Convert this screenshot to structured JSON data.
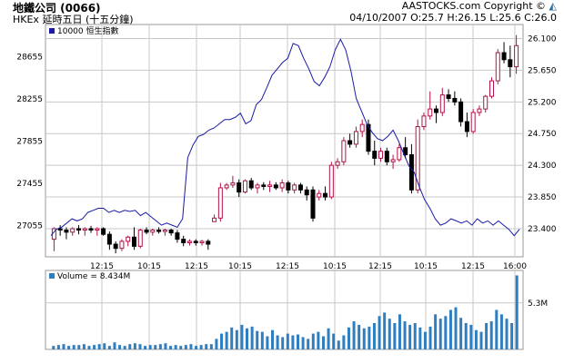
{
  "header": {
    "title": "地鐵公司 (0066)",
    "subtitle": "HKEx 延時五日 (十五分鐘)",
    "copyright": "AASTOCKS.com Copyright ©",
    "quote_line": "04/10/2007  O:25.7  H:26.15  L:25.6  C:26.0"
  },
  "colors": {
    "up": "#b0124a",
    "down": "#000000",
    "index_line": "#1a1aa6",
    "volume": "#2f7fc0",
    "grid": "#c8c8c8",
    "frame": "#999999"
  },
  "chart_data": [
    {
      "type": "candlestick",
      "title": "",
      "x_tick_labels": [
        "12:15",
        "10:15",
        "12:15",
        "10:15",
        "12:15",
        "10:15",
        "12:15",
        "10:15",
        "12:15",
        "16:00"
      ],
      "y_right_ticks": [
        23.4,
        23.85,
        24.3,
        24.75,
        25.2,
        25.65,
        26.1
      ],
      "y_left_ticks": [
        27055,
        27455,
        27855,
        28255,
        28655
      ],
      "ylim_price": [
        23.0,
        26.3
      ],
      "ylim_index": [
        26760,
        28960
      ],
      "legend": "10000 恒生指數",
      "candles": [
        {
          "o": 23.25,
          "h": 23.42,
          "l": 23.08,
          "c": 23.4
        },
        {
          "o": 23.4,
          "h": 23.45,
          "l": 23.3,
          "c": 23.38
        },
        {
          "o": 23.38,
          "h": 23.42,
          "l": 23.25,
          "c": 23.35
        },
        {
          "o": 23.35,
          "h": 23.42,
          "l": 23.3,
          "c": 23.4
        },
        {
          "o": 23.4,
          "h": 23.45,
          "l": 23.32,
          "c": 23.38
        },
        {
          "o": 23.38,
          "h": 23.42,
          "l": 23.3,
          "c": 23.4
        },
        {
          "o": 23.4,
          "h": 23.44,
          "l": 23.34,
          "c": 23.38
        },
        {
          "o": 23.38,
          "h": 23.42,
          "l": 23.3,
          "c": 23.4
        },
        {
          "o": 23.4,
          "h": 23.42,
          "l": 23.3,
          "c": 23.32
        },
        {
          "o": 23.32,
          "h": 23.36,
          "l": 23.1,
          "c": 23.18
        },
        {
          "o": 23.18,
          "h": 23.22,
          "l": 23.05,
          "c": 23.12
        },
        {
          "o": 23.12,
          "h": 23.25,
          "l": 23.08,
          "c": 23.22
        },
        {
          "o": 23.22,
          "h": 23.3,
          "l": 23.15,
          "c": 23.28
        },
        {
          "o": 23.28,
          "h": 23.42,
          "l": 23.1,
          "c": 23.15
        },
        {
          "o": 23.15,
          "h": 23.4,
          "l": 23.12,
          "c": 23.38
        },
        {
          "o": 23.38,
          "h": 23.42,
          "l": 23.32,
          "c": 23.35
        },
        {
          "o": 23.35,
          "h": 23.4,
          "l": 23.3,
          "c": 23.38
        },
        {
          "o": 23.38,
          "h": 23.42,
          "l": 23.33,
          "c": 23.36
        },
        {
          "o": 23.36,
          "h": 23.4,
          "l": 23.3,
          "c": 23.38
        },
        {
          "o": 23.38,
          "h": 23.4,
          "l": 23.3,
          "c": 23.34
        },
        {
          "o": 23.34,
          "h": 23.38,
          "l": 23.2,
          "c": 23.25
        },
        {
          "o": 23.25,
          "h": 23.3,
          "l": 23.15,
          "c": 23.2
        },
        {
          "o": 23.2,
          "h": 23.25,
          "l": 23.16,
          "c": 23.22
        },
        {
          "o": 23.22,
          "h": 23.25,
          "l": 23.16,
          "c": 23.2
        },
        {
          "o": 23.2,
          "h": 23.24,
          "l": 23.16,
          "c": 23.22
        },
        {
          "o": 23.22,
          "h": 23.25,
          "l": 23.1,
          "c": 23.18
        },
        {
          "o": 23.5,
          "h": 23.6,
          "l": 23.5,
          "c": 23.55
        },
        {
          "o": 23.55,
          "h": 24.05,
          "l": 23.5,
          "c": 23.98
        },
        {
          "o": 23.98,
          "h": 24.05,
          "l": 23.95,
          "c": 24.02
        },
        {
          "o": 24.02,
          "h": 24.15,
          "l": 23.98,
          "c": 24.05
        },
        {
          "o": 24.05,
          "h": 24.1,
          "l": 23.85,
          "c": 23.92
        },
        {
          "o": 23.92,
          "h": 24.1,
          "l": 23.9,
          "c": 24.08
        },
        {
          "o": 24.08,
          "h": 24.12,
          "l": 23.95,
          "c": 23.98
        },
        {
          "o": 23.98,
          "h": 24.05,
          "l": 23.9,
          "c": 24.02
        },
        {
          "o": 24.02,
          "h": 24.06,
          "l": 23.95,
          "c": 24.0
        },
        {
          "o": 24.0,
          "h": 24.08,
          "l": 23.92,
          "c": 24.02
        },
        {
          "o": 24.02,
          "h": 24.06,
          "l": 23.95,
          "c": 23.98
        },
        {
          "o": 23.98,
          "h": 24.1,
          "l": 23.92,
          "c": 24.05
        },
        {
          "o": 24.05,
          "h": 24.08,
          "l": 23.9,
          "c": 23.95
        },
        {
          "o": 23.95,
          "h": 24.05,
          "l": 23.9,
          "c": 24.02
        },
        {
          "o": 24.02,
          "h": 24.05,
          "l": 23.9,
          "c": 23.95
        },
        {
          "o": 23.95,
          "h": 24.0,
          "l": 23.8,
          "c": 23.88
        },
        {
          "o": 23.95,
          "h": 24.0,
          "l": 23.5,
          "c": 23.55
        },
        {
          "o": 23.85,
          "h": 23.95,
          "l": 23.8,
          "c": 23.9
        },
        {
          "o": 23.9,
          "h": 24.0,
          "l": 23.8,
          "c": 23.85
        },
        {
          "o": 23.85,
          "h": 24.35,
          "l": 23.82,
          "c": 24.3
        },
        {
          "o": 24.3,
          "h": 24.4,
          "l": 24.25,
          "c": 24.35
        },
        {
          "o": 24.35,
          "h": 24.7,
          "l": 24.3,
          "c": 24.65
        },
        {
          "o": 24.65,
          "h": 24.75,
          "l": 24.55,
          "c": 24.6
        },
        {
          "o": 24.6,
          "h": 24.85,
          "l": 24.55,
          "c": 24.78
        },
        {
          "o": 24.78,
          "h": 24.95,
          "l": 24.7,
          "c": 24.88
        },
        {
          "o": 24.88,
          "h": 24.95,
          "l": 24.45,
          "c": 24.5
        },
        {
          "o": 24.5,
          "h": 24.65,
          "l": 24.3,
          "c": 24.4
        },
        {
          "o": 24.4,
          "h": 24.55,
          "l": 24.35,
          "c": 24.5
        },
        {
          "o": 24.5,
          "h": 24.55,
          "l": 24.3,
          "c": 24.35
        },
        {
          "o": 24.35,
          "h": 24.45,
          "l": 24.25,
          "c": 24.38
        },
        {
          "o": 24.38,
          "h": 24.6,
          "l": 24.35,
          "c": 24.55
        },
        {
          "o": 24.55,
          "h": 24.7,
          "l": 24.4,
          "c": 24.45
        },
        {
          "o": 24.45,
          "h": 24.6,
          "l": 23.9,
          "c": 23.95
        },
        {
          "o": 23.95,
          "h": 24.95,
          "l": 23.9,
          "c": 24.85
        },
        {
          "o": 24.85,
          "h": 25.05,
          "l": 24.8,
          "c": 25.0
        },
        {
          "o": 25.0,
          "h": 25.35,
          "l": 24.95,
          "c": 25.1
        },
        {
          "o": 25.1,
          "h": 25.15,
          "l": 24.9,
          "c": 25.05
        },
        {
          "o": 25.05,
          "h": 25.4,
          "l": 25.0,
          "c": 25.3
        },
        {
          "o": 25.3,
          "h": 25.38,
          "l": 25.2,
          "c": 25.25
        },
        {
          "o": 25.25,
          "h": 25.35,
          "l": 25.15,
          "c": 25.2
        },
        {
          "o": 25.2,
          "h": 25.25,
          "l": 24.85,
          "c": 24.92
        },
        {
          "o": 24.92,
          "h": 25.05,
          "l": 24.7,
          "c": 24.78
        },
        {
          "o": 24.78,
          "h": 25.1,
          "l": 24.75,
          "c": 25.05
        },
        {
          "o": 25.05,
          "h": 25.15,
          "l": 25.0,
          "c": 25.1
        },
        {
          "o": 25.1,
          "h": 25.3,
          "l": 25.05,
          "c": 25.28
        },
        {
          "o": 25.28,
          "h": 25.55,
          "l": 25.25,
          "c": 25.5
        },
        {
          "o": 25.5,
          "h": 25.95,
          "l": 25.45,
          "c": 25.9
        },
        {
          "o": 25.9,
          "h": 26.05,
          "l": 25.75,
          "c": 25.8
        },
        {
          "o": 25.8,
          "h": 26.0,
          "l": 25.55,
          "c": 25.7
        },
        {
          "o": 25.7,
          "h": 26.15,
          "l": 25.6,
          "c": 26.0
        }
      ],
      "index_series": [
        26960,
        27020,
        27040,
        27080,
        27120,
        27100,
        27120,
        27180,
        27200,
        27220,
        27220,
        27180,
        27200,
        27180,
        27200,
        27190,
        27200,
        27150,
        27180,
        27140,
        27100,
        27060,
        27080,
        27060,
        27040,
        27120,
        27700,
        27820,
        27900,
        27920,
        27960,
        27980,
        28020,
        28060,
        28060,
        28080,
        28120,
        28020,
        28050,
        28200,
        28250,
        28360,
        28480,
        28540,
        28600,
        28640,
        28780,
        28760,
        28640,
        28540,
        28420,
        28380,
        28460,
        28560,
        28720,
        28820,
        28720,
        28520,
        28260,
        28140,
        28020,
        27940,
        27880,
        27860,
        27900,
        27960,
        27860,
        27740,
        27620,
        27560,
        27420,
        27300,
        27220,
        27120,
        27060,
        27080,
        27120,
        27100,
        27080,
        27100,
        27060,
        27120,
        27080,
        27100,
        27060,
        27100,
        27060,
        27020,
        26960,
        27020
      ]
    },
    {
      "type": "bar",
      "title": "",
      "legend_label": "Volume = 8.434M",
      "y_tick_label": "5.3M",
      "y_tick_value": 5.3,
      "ylim": [
        0,
        9.0
      ],
      "unit": "M",
      "values": [
        0.4,
        0.5,
        0.6,
        0.4,
        0.5,
        0.5,
        0.6,
        0.4,
        0.5,
        0.6,
        0.7,
        0.4,
        0.8,
        0.5,
        0.4,
        0.6,
        0.7,
        0.6,
        0.4,
        0.5,
        0.5,
        0.6,
        0.7,
        0.4,
        0.5,
        0.4,
        0.5,
        0.6,
        0.4,
        0.5,
        0.6,
        0.6,
        1.2,
        1.8,
        2.0,
        2.5,
        2.2,
        2.8,
        2.4,
        2.6,
        2.1,
        2.0,
        1.5,
        2.2,
        1.6,
        1.4,
        1.8,
        1.6,
        1.7,
        1.4,
        1.2,
        1.8,
        2.0,
        1.5,
        2.4,
        1.8,
        1.0,
        1.6,
        2.5,
        3.2,
        2.8,
        2.4,
        2.6,
        3.0,
        3.8,
        4.2,
        3.5,
        3.0,
        4.0,
        3.2,
        2.8,
        3.0,
        2.5,
        2.0,
        2.6,
        4.0,
        3.5,
        3.8,
        4.5,
        4.8,
        3.6,
        3.0,
        2.8,
        2.2,
        2.0,
        3.0,
        3.2,
        4.5,
        4.0,
        3.5,
        3.0,
        8.434
      ]
    }
  ]
}
